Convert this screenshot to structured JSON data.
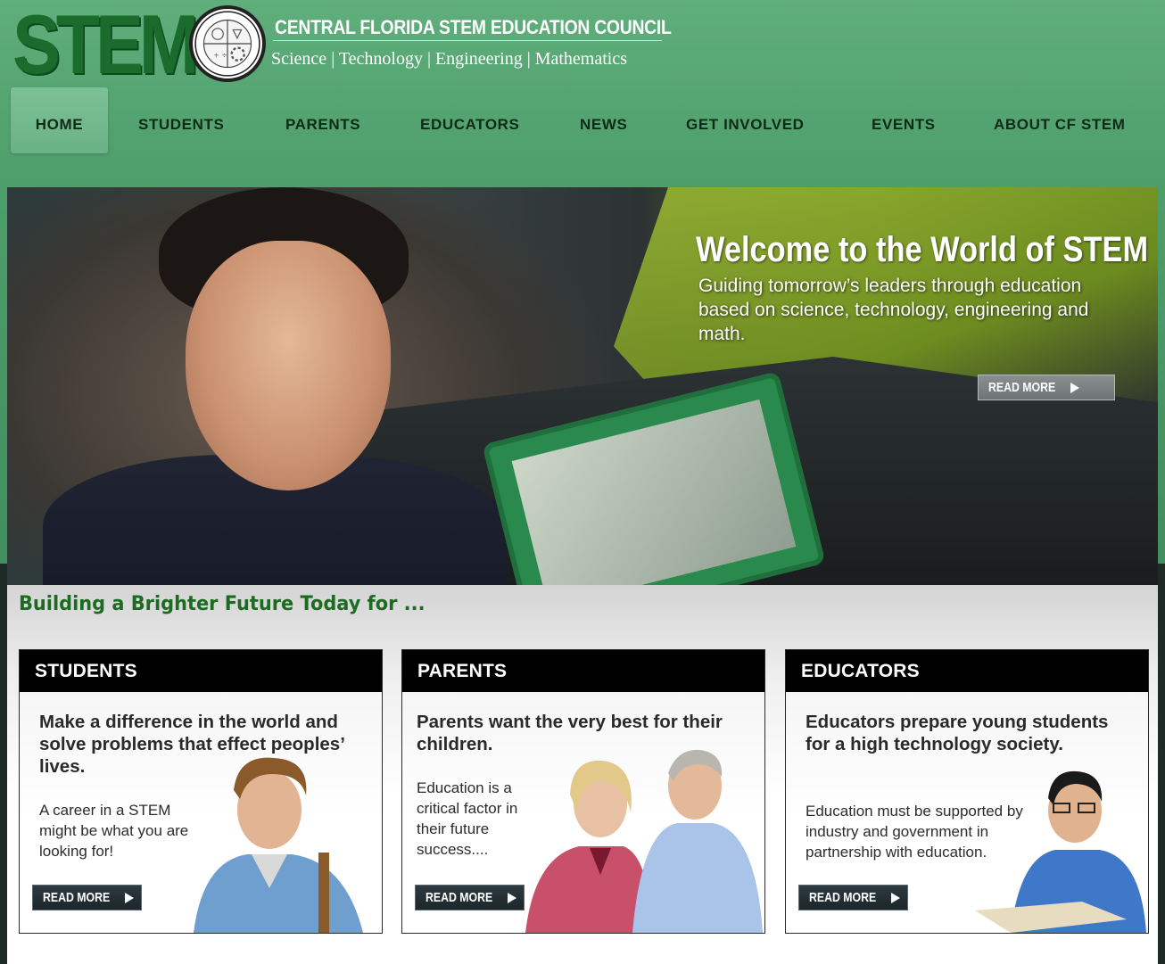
{
  "header": {
    "logo_text": "STEM",
    "org_name": "CENTRAL FLORIDA STEM EDUCATION COUNCIL",
    "tagline": "Science | Technology | Engineering | Mathematics"
  },
  "nav": {
    "items": [
      {
        "label": "HOME",
        "active": true
      },
      {
        "label": "STUDENTS",
        "active": false
      },
      {
        "label": "PARENTS",
        "active": false
      },
      {
        "label": "EDUCATORS",
        "active": false
      },
      {
        "label": "NEWS",
        "active": false
      },
      {
        "label": "GET INVOLVED",
        "active": false
      },
      {
        "label": "EVENTS",
        "active": false
      },
      {
        "label": "ABOUT CF STEM",
        "active": false
      }
    ]
  },
  "hero": {
    "title": "Welcome to the World of STEM",
    "subtitle": "Guiding tomorrow’s leaders through education based on science, technology, engineering and math.",
    "button_label": "READ MORE"
  },
  "section": {
    "heading": "Building a Brighter Future Today for ..."
  },
  "cards": [
    {
      "title": "STUDENTS",
      "headline": "Make a difference in the world and solve problems that effect peoples’ lives.",
      "body": "A career in a STEM might be what you are looking for!",
      "button_label": "READ MORE"
    },
    {
      "title": "PARENTS",
      "headline": "Parents want the very best for their children.",
      "body": "Education is a critical factor in their future success....",
      "button_label": "READ MORE"
    },
    {
      "title": "EDUCATORS",
      "headline": "Educators prepare young students for a high technology society.",
      "body": "Education must be supported by industry and government in partnership with education.",
      "button_label": "READ MORE"
    }
  ],
  "colors": {
    "header_green": "#4f9f6d",
    "logo_green": "#1a6b2c",
    "heading_green": "#1d6b22",
    "card_header_black": "#000000"
  }
}
